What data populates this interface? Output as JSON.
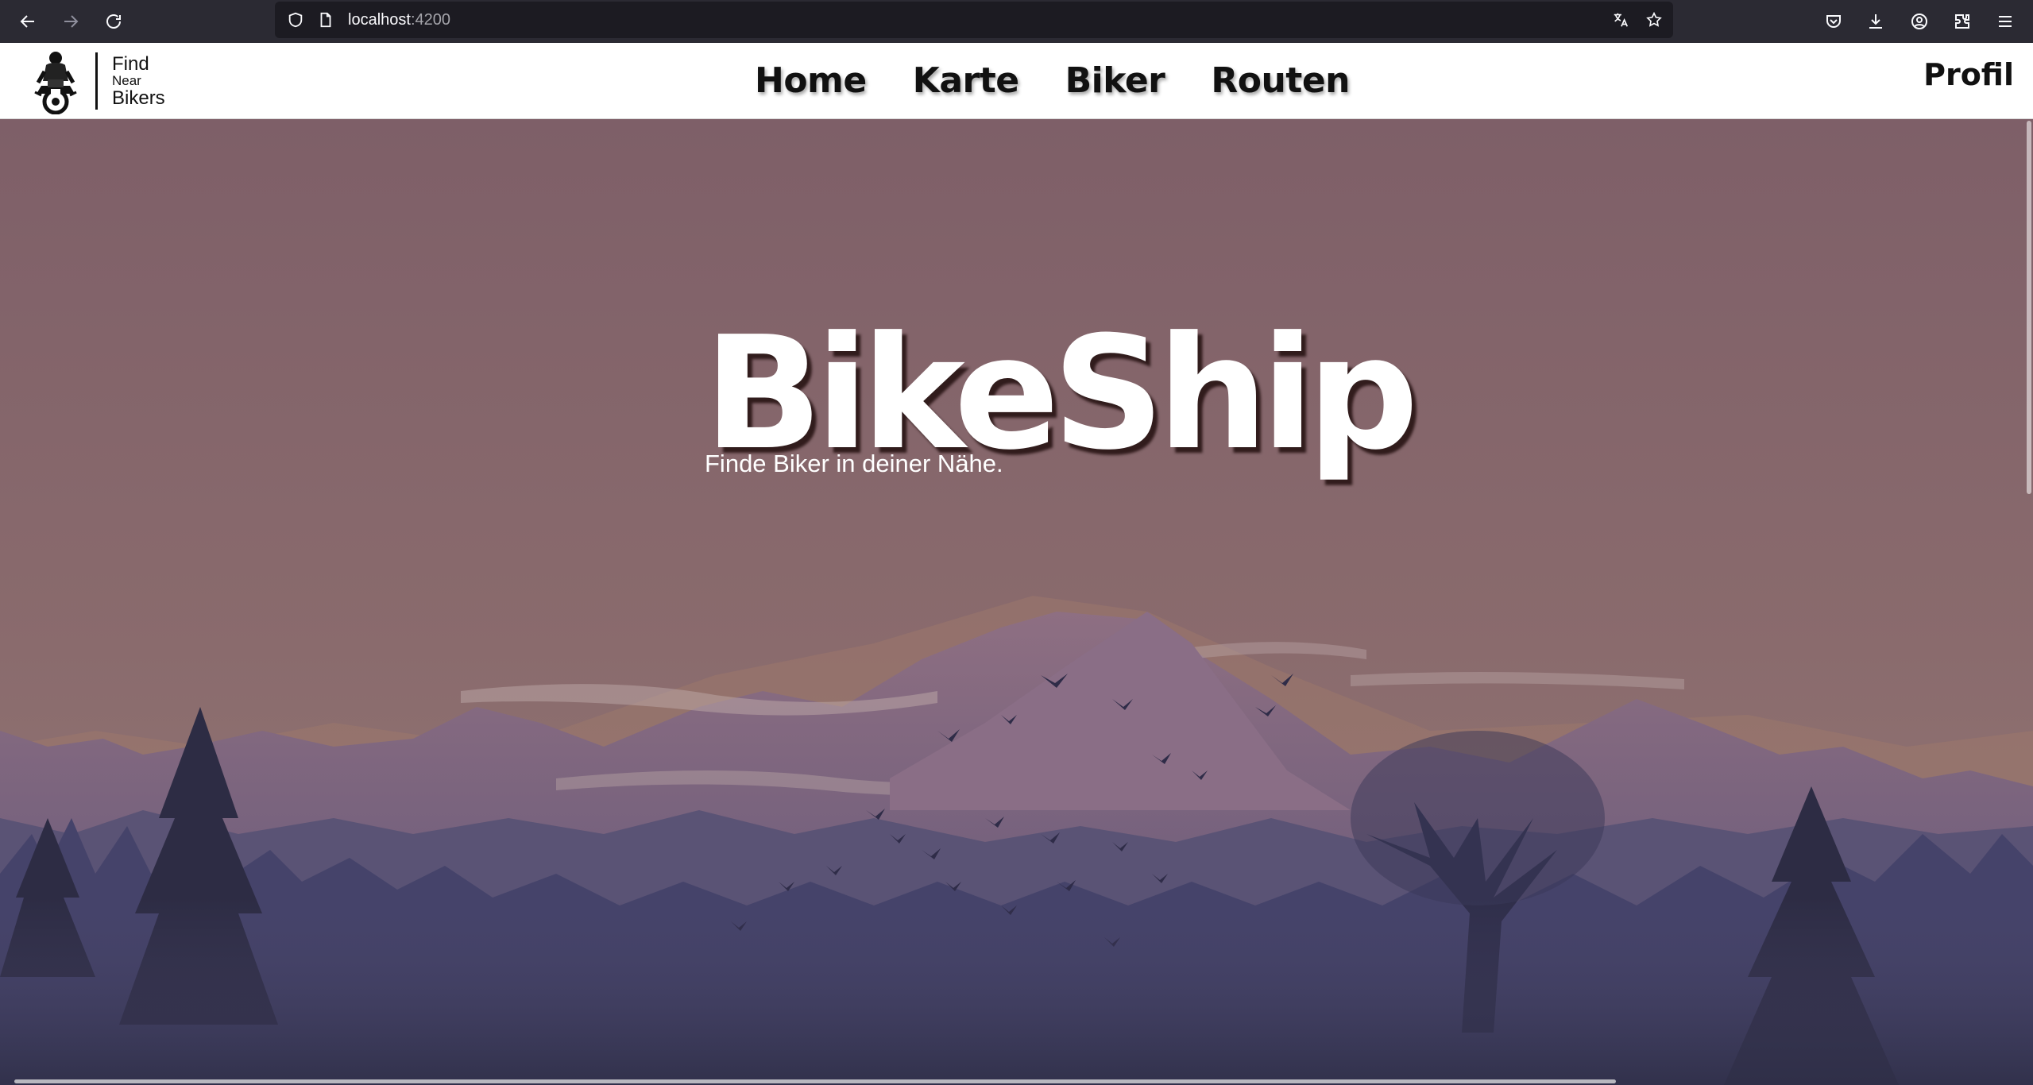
{
  "browser": {
    "url_host": "localhost",
    "url_port": ":4200"
  },
  "navbar": {
    "logo": {
      "line1": "Find",
      "line2": "Near",
      "line3": "Bikers"
    },
    "links": [
      "Home",
      "Karte",
      "Biker",
      "Routen"
    ],
    "profile": "Profil"
  },
  "hero": {
    "title": "BikeShip",
    "subtitle": "Finde Biker in deiner Nähe."
  },
  "colors": {
    "sky_top": "#7e5f68",
    "sky_bottom": "#8a6a6e",
    "mountain_far": "#6c5d78",
    "mountain_mid": "#5a5375",
    "forest": "#3d3d5c",
    "toolbar": "#2b2a33"
  }
}
